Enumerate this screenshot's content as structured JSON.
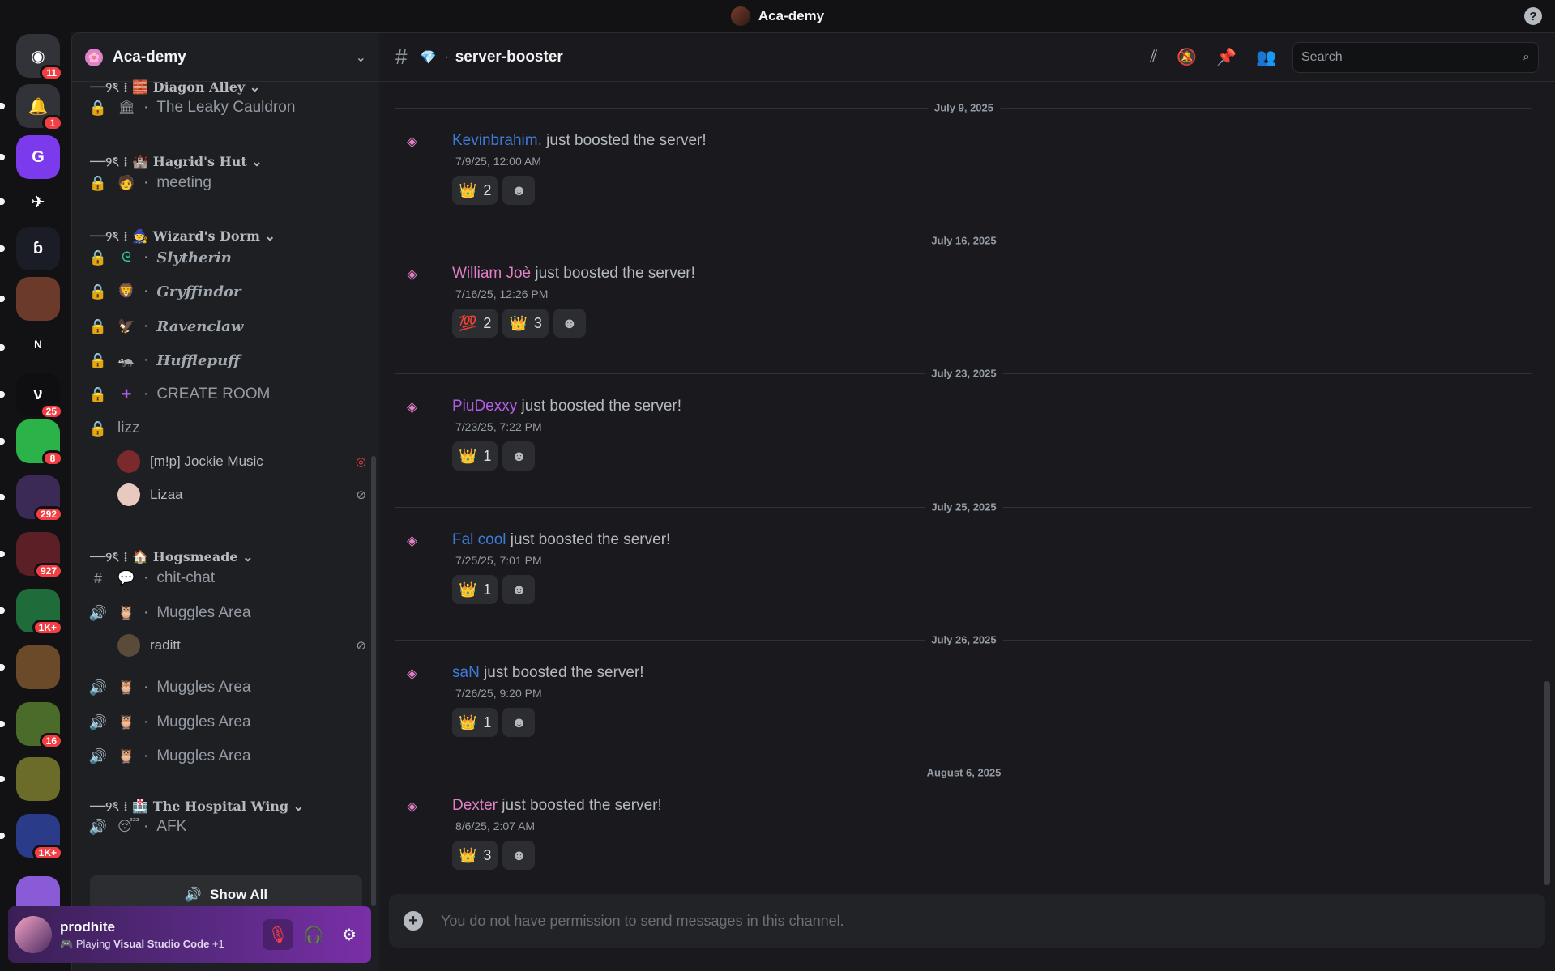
{
  "window": {
    "title": "Aca-demy",
    "help": "?"
  },
  "rail": {
    "servers": [
      {
        "name": "discord-home",
        "badge": "11",
        "color": "#313338",
        "glyph": "◉"
      },
      {
        "name": "notifications",
        "badge": "1",
        "color": "#313338",
        "glyph": "🔔"
      },
      {
        "name": "server-g",
        "badge": "",
        "color": "#7c3aed",
        "glyph": "G"
      },
      {
        "name": "server-findsky",
        "badge": "",
        "color": "#121214",
        "glyph": "✈"
      },
      {
        "name": "server-b",
        "badge": "",
        "color": "#1b1d26",
        "glyph": "ɓ"
      },
      {
        "name": "server-portrait",
        "badge": "",
        "color": "#6b3a2a",
        "glyph": ""
      },
      {
        "name": "server-ninja",
        "badge": "",
        "color": "#121214",
        "glyph": "ᴺ"
      },
      {
        "name": "server-v",
        "badge": "25",
        "color": "#0f0f12",
        "glyph": "ν"
      },
      {
        "name": "server-avatar",
        "badge": "8",
        "color": "#2bb34a",
        "glyph": ""
      },
      {
        "name": "server-folder-1",
        "badge": "292",
        "color": "#3b2a55",
        "glyph": ""
      },
      {
        "name": "server-folder-2",
        "badge": "927",
        "color": "#5b1f25",
        "glyph": ""
      },
      {
        "name": "server-folder-3",
        "badge": "1K+",
        "color": "#1f6b3a",
        "glyph": ""
      },
      {
        "name": "server-folder-4",
        "badge": "",
        "color": "#6b4a2a",
        "glyph": ""
      },
      {
        "name": "server-folder-5",
        "badge": "16",
        "color": "#4a6b2a",
        "glyph": ""
      },
      {
        "name": "server-folder-6",
        "badge": "",
        "color": "#6b6b2a",
        "glyph": ""
      },
      {
        "name": "server-folder-7",
        "badge": "1K+",
        "color": "#2a3b8a",
        "glyph": ""
      },
      {
        "name": "server-folder-8",
        "badge": "",
        "color": "#8a5bd6",
        "glyph": ""
      }
    ]
  },
  "sidebar": {
    "guild_name": "Aca-demy",
    "cat_diagon": "──୨ৎ ⁞ 🧱 Diagon Alley ⌄",
    "ch_leaky": "The Leaky Cauldron",
    "cat_hagrid": "──୨ৎ ⁞ 🏰 Hagrid's Hut ⌄",
    "ch_meeting": "meeting",
    "cat_dorm": "──୨ৎ ⁞ 🧙 Wizard's Dorm ⌄",
    "ch_slytherin": "Slytherin",
    "ch_gryffindor": "Gryffindor",
    "ch_ravenclaw": "Ravenclaw",
    "ch_hufflepuff": "Hufflepuff",
    "ch_create": "CREATE ROOM",
    "ch_lizz": "lizz",
    "vu_jockie": "[m!p] Jockie Music",
    "vu_lizaa": "Lizaa",
    "cat_hogsmeade": "──୨ৎ ⁞ 🏠 Hogsmeade ⌄",
    "ch_chitchat": "chit-chat",
    "ch_muggles1": "Muggles Area",
    "vu_raditt": "raditt",
    "ch_muggles2": "Muggles Area",
    "ch_muggles3": "Muggles Area",
    "ch_muggles4": "Muggles Area",
    "cat_hospital": "──୨ৎ ⁞ 🏥 The Hospital Wing ⌄",
    "ch_afk": "AFK",
    "show_all": "Show All"
  },
  "user": {
    "name": "prodhite",
    "status_prefix": "Playing",
    "status_game": "Visual Studio Code",
    "status_more": "+1"
  },
  "channel": {
    "name": "server-booster"
  },
  "search": {
    "placeholder": "Search"
  },
  "messages": [
    {
      "date": "July 9, 2025",
      "user": "Kevinbrahim.",
      "color": "#3e7bd9",
      "text": "just boosted the server!",
      "time": "7/9/25, 12:00 AM",
      "reactions": [
        {
          "emoji": "👑",
          "count": "2"
        }
      ]
    },
    {
      "date": "July 16, 2025",
      "user": "William Joè",
      "color": "#e37fc7",
      "text": "just boosted the server!",
      "time": "7/16/25, 12:26 PM",
      "reactions": [
        {
          "emoji": "💯",
          "count": "2"
        },
        {
          "emoji": "👑",
          "count": "3"
        }
      ]
    },
    {
      "date": "July 23, 2025",
      "user": "PiuDexxy",
      "color": "#b15de6",
      "text": "just boosted the server!",
      "time": "7/23/25, 7:22 PM",
      "reactions": [
        {
          "emoji": "👑",
          "count": "1"
        }
      ]
    },
    {
      "date": "July 25, 2025",
      "user": "Fal cool",
      "color": "#3e7bd9",
      "text": "just boosted the server!",
      "time": "7/25/25, 7:01 PM",
      "reactions": [
        {
          "emoji": "👑",
          "count": "1"
        }
      ]
    },
    {
      "date": "July 26, 2025",
      "user": "saN",
      "color": "#3e7bd9",
      "text": "just boosted the server!",
      "time": "7/26/25, 9:20 PM",
      "reactions": [
        {
          "emoji": "👑",
          "count": "1"
        }
      ]
    },
    {
      "date": "August 6, 2025",
      "user": "Dexter",
      "color": "#e37fc7",
      "text": "just boosted the server!",
      "time": "8/6/25, 2:07 AM",
      "reactions": [
        {
          "emoji": "👑",
          "count": "3"
        }
      ]
    }
  ],
  "composer": {
    "placeholder": "You do not have permission to send messages in this channel."
  }
}
